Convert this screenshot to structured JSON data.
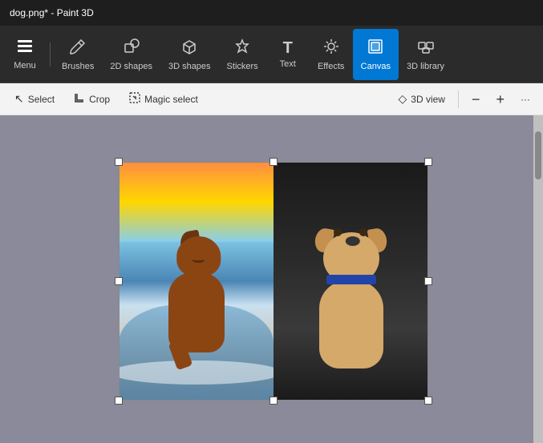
{
  "titleBar": {
    "title": "dog.png* - Paint 3D"
  },
  "toolbar": {
    "items": [
      {
        "id": "menu",
        "label": "Menu",
        "icon": "☰"
      },
      {
        "id": "brushes",
        "label": "Brushes",
        "icon": "🖌"
      },
      {
        "id": "2dshapes",
        "label": "2D shapes",
        "icon": "⬡"
      },
      {
        "id": "3dshapes",
        "label": "3D shapes",
        "icon": "⬡"
      },
      {
        "id": "stickers",
        "label": "Stickers",
        "icon": "✨"
      },
      {
        "id": "text",
        "label": "Text",
        "icon": "T"
      },
      {
        "id": "effects",
        "label": "Effects",
        "icon": "☀"
      },
      {
        "id": "canvas",
        "label": "Canvas",
        "icon": "⊡",
        "active": true
      },
      {
        "id": "3dlibrary",
        "label": "3D library",
        "icon": "⊞"
      }
    ]
  },
  "subToolbar": {
    "leftItems": [
      {
        "id": "select",
        "label": "Select",
        "icon": "↖"
      },
      {
        "id": "crop",
        "label": "Crop",
        "icon": "⊡"
      },
      {
        "id": "magic-select",
        "label": "Magic select",
        "icon": "⊠"
      }
    ],
    "rightItems": [
      {
        "id": "3dview",
        "label": "3D view",
        "icon": "◇"
      },
      {
        "id": "zoom-out",
        "label": "−",
        "icon": "−"
      },
      {
        "id": "zoom-in",
        "label": "+",
        "icon": "+"
      },
      {
        "id": "more",
        "label": "···",
        "icon": "···"
      }
    ]
  }
}
